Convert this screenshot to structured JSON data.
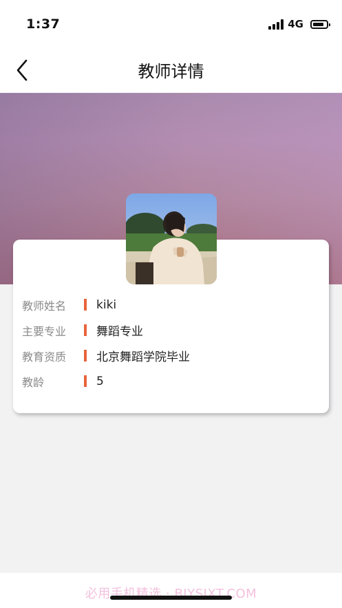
{
  "status_bar": {
    "time": "1:37",
    "network": "4G"
  },
  "header": {
    "title": "教师详情",
    "back_icon": "chevron-left-icon"
  },
  "teacher": {
    "avatar_icon": "teacher-photo",
    "details": [
      {
        "label": "教师姓名",
        "value": "kiki"
      },
      {
        "label": "主要专业",
        "value": "舞蹈专业"
      },
      {
        "label": "教育资质",
        "value": "北京舞蹈学院毕业"
      },
      {
        "label": "教龄",
        "value": "5"
      }
    ]
  },
  "footer": {
    "watermark": "必用手机精选 · BIYSJXT.COM"
  },
  "colors": {
    "accent_bar": "#e8643c",
    "label_gray": "#8a8a8a",
    "hero_purple": "#b48eb2"
  }
}
